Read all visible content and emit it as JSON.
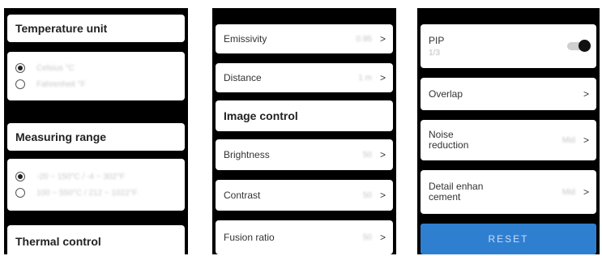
{
  "left": {
    "temperature_unit": {
      "title": "Temperature unit",
      "options": [
        "Celsius °C",
        "Fahrenheit °F"
      ],
      "selected": 0
    },
    "measuring_range": {
      "title": "Measuring range",
      "options": [
        "-20 ~ 150°C / -4 ~ 302°F",
        "100 ~ 550°C / 212 ~ 1022°F"
      ],
      "selected": 0
    },
    "thermal_control": {
      "title": "Thermal control"
    }
  },
  "middle": {
    "emissivity": {
      "label": "Emissivity",
      "value": "0.95"
    },
    "distance": {
      "label": "Distance",
      "value": "1 m"
    },
    "image_control": {
      "title": "Image control"
    },
    "brightness": {
      "label": "Brightness",
      "value": "50"
    },
    "contrast": {
      "label": "Contrast",
      "value": "50"
    },
    "fusion_ratio": {
      "label": "Fusion ratio",
      "value": "50"
    },
    "chevron": ">"
  },
  "right": {
    "pip": {
      "label": "PIP",
      "value": "1/3",
      "enabled": true
    },
    "overlap": {
      "label": "Overlap"
    },
    "noise_reduction": {
      "label": "Noise\nreduction",
      "value": "Mid"
    },
    "detail_enhancement": {
      "label": "Detail enhan\ncement",
      "value": "Mid"
    },
    "reset_label": "RESET",
    "chevron": ">"
  },
  "colors": {
    "panel_bg": "#000000",
    "card_bg": "#ffffff",
    "accent_blue": "#2f7fd1"
  }
}
